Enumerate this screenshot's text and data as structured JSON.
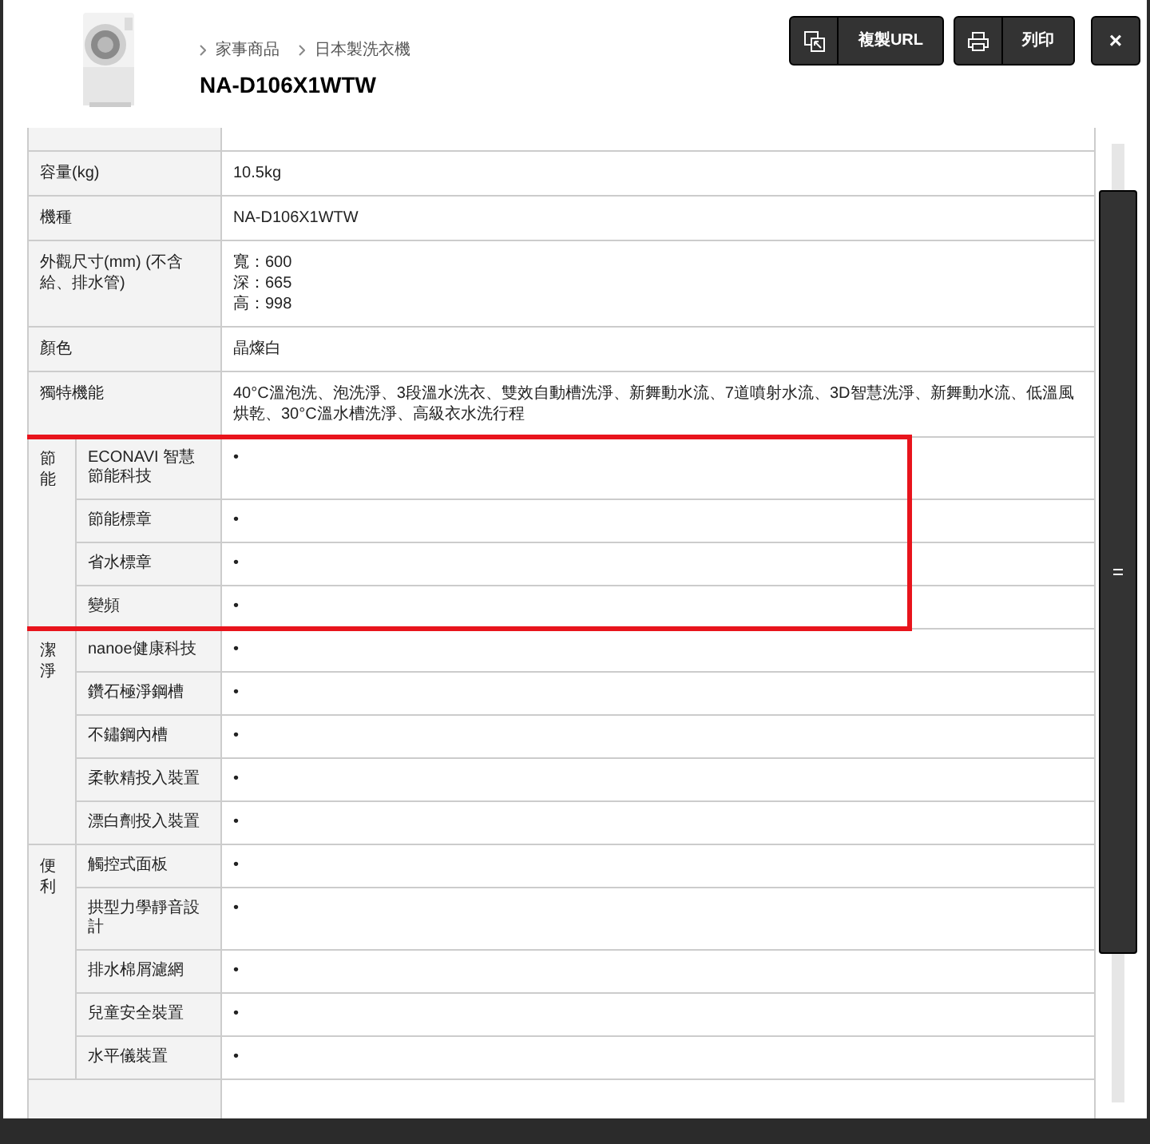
{
  "breadcrumb": [
    "家事商品",
    "日本製洗衣機"
  ],
  "title": "NA-D106X1WTW",
  "buttons": [
    {
      "kind": "copy",
      "label": "複製URL"
    },
    {
      "kind": "print",
      "label": "列印"
    },
    {
      "kind": "close",
      "label": "×"
    }
  ],
  "specs": [
    {
      "label": "容量(kg)",
      "value": [
        "10.5kg"
      ]
    },
    {
      "label": "機種",
      "value": [
        "NA-D106X1WTW"
      ]
    },
    {
      "label": "外觀尺寸(mm) (不含給、排水管)",
      "value": [
        "寬：600",
        "深：665",
        "高：998"
      ]
    },
    {
      "label": "顏色",
      "value": [
        "晶燦白"
      ]
    },
    {
      "label": "獨特機能",
      "value": [
        "40°C溫泡洗、泡洗淨、3段溫水洗衣、雙效自動槽洗淨、新舞動水流、7道噴射水流、3D智慧洗淨、新舞動水流、低溫風烘乾、30°C溫水槽洗淨、高級衣水洗行程"
      ]
    }
  ],
  "groups": [
    {
      "label": "節能",
      "highlighted": true,
      "items": [
        {
          "label": "ECONAVI 智慧節能科技",
          "value": "•"
        },
        {
          "label": "節能標章",
          "value": "•"
        },
        {
          "label": "省水標章",
          "value": "•"
        },
        {
          "label": "變頻",
          "value": "•"
        }
      ]
    },
    {
      "label": "潔淨",
      "highlighted": false,
      "items": [
        {
          "label": "nanoe健康科技",
          "value": "•"
        },
        {
          "label": "鑽石極淨鋼槽",
          "value": "•"
        },
        {
          "label": "不鏽鋼內槽",
          "value": "•"
        },
        {
          "label": "柔軟精投入裝置",
          "value": "•"
        },
        {
          "label": "漂白劑投入裝置",
          "value": "•"
        }
      ]
    },
    {
      "label": "便利",
      "highlighted": false,
      "items": [
        {
          "label": "觸控式面板",
          "value": "•"
        },
        {
          "label": "拱型力學靜音設計",
          "value": "•"
        },
        {
          "label": "排水棉屑濾網",
          "value": "•"
        },
        {
          "label": "兒童安全裝置",
          "value": "•"
        },
        {
          "label": "水平儀裝置",
          "value": "•"
        }
      ]
    }
  ]
}
